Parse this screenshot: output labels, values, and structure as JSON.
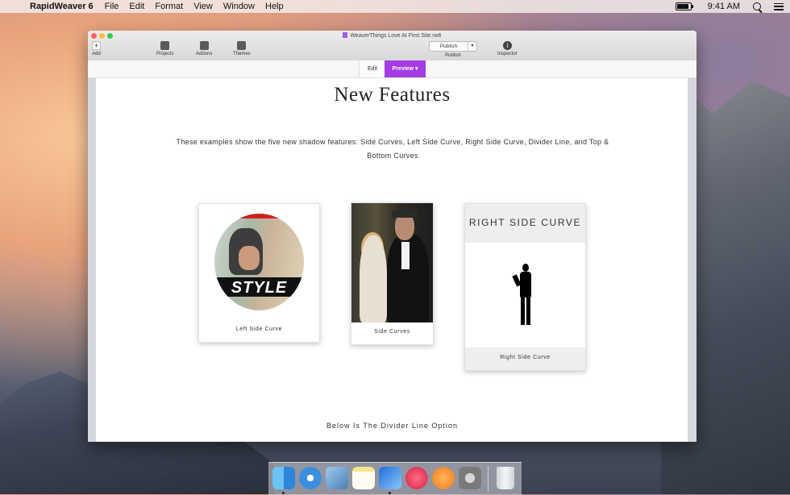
{
  "menubar": {
    "app_name": "RapidWeaver 6",
    "items": [
      "File",
      "Edit",
      "Format",
      "View",
      "Window",
      "Help"
    ],
    "clock": "9:41 AM"
  },
  "window": {
    "title": "WeaverThings Love At First Site.rw6",
    "toolbar": {
      "add": "Add",
      "projects": "Projects",
      "addons": "Addons",
      "themes": "Themes",
      "publish_button": "Publish",
      "publish_caption": "Publish",
      "inspector": "Inspector"
    },
    "modes": {
      "edit": "Edit",
      "preview": "Preview"
    }
  },
  "page": {
    "heading": "New Features",
    "intro": "These examples show the five new shadow features: Side Curves, Left Side Curve, Right Side Curve, Divider Line, and Top & Bottom Curves",
    "cards": [
      {
        "caption": "Left Side Curve",
        "image_text": "STYLE"
      },
      {
        "caption": "Side Curves"
      },
      {
        "caption": "Right Side Curve",
        "header": "RIGHT SIDE CURVE"
      }
    ],
    "divider_text": "Below Is The Divider Line Option"
  },
  "dock": {
    "apps": [
      "finder",
      "safari",
      "preview",
      "notes",
      "xcode",
      "itunes",
      "ibooks",
      "system-preferences",
      "trash"
    ]
  },
  "colors": {
    "preview_accent": "#a33de2",
    "doc_icon": "#9b5de5"
  }
}
